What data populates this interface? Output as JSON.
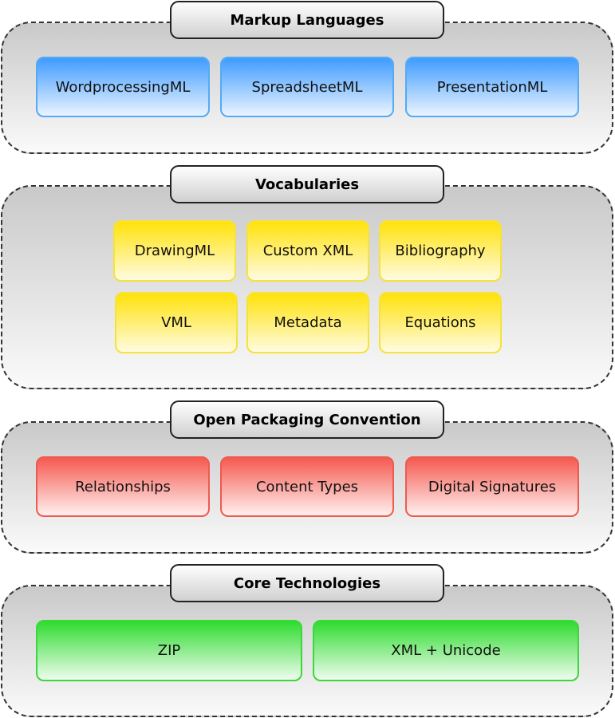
{
  "diagram": {
    "layers": [
      {
        "title": "Markup Languages",
        "color": "#3f9cff",
        "items": [
          "WordprocessingML",
          "SpreadsheetML",
          "PresentationML"
        ]
      },
      {
        "title": "Vocabularies",
        "color": "#ffe20a",
        "items": [
          "DrawingML",
          "Custom XML",
          "Bibliography",
          "VML",
          "Metadata",
          "Equations"
        ]
      },
      {
        "title": "Open Packaging Convention",
        "color": "#f55a50",
        "items": [
          "Relationships",
          "Content Types",
          "Digital Signatures"
        ]
      },
      {
        "title": "Core Technologies",
        "color": "#2fdc2f",
        "items": [
          "ZIP",
          "XML + Unicode"
        ]
      }
    ]
  }
}
